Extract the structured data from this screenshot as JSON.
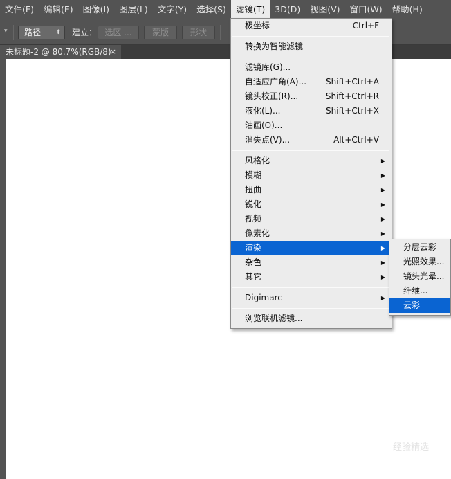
{
  "menubar": {
    "items": [
      "文件(F)",
      "编辑(E)",
      "图像(I)",
      "图层(L)",
      "文字(Y)",
      "选择(S)",
      "滤镜(T)",
      "3D(D)",
      "视图(V)",
      "窗口(W)",
      "帮助(H)"
    ]
  },
  "options": {
    "tool_preset_icon": "dropdown-arrow",
    "path_mode": "路径",
    "make_label": "建立：",
    "selection_button": "选区 ...",
    "mask_button": "蒙版",
    "shape_button": "形状"
  },
  "document": {
    "tab_title": "未标题-2 @ 80.7%(RGB/8)",
    "close_glyph": "×"
  },
  "filter_menu": {
    "groups": [
      [
        {
          "label": "极坐标",
          "shortcut": "Ctrl+F"
        }
      ],
      [
        {
          "label": "转换为智能滤镜",
          "shortcut": ""
        }
      ],
      [
        {
          "label": "滤镜库(G)...",
          "shortcut": ""
        },
        {
          "label": "自适应广角(A)...",
          "shortcut": "Shift+Ctrl+A"
        },
        {
          "label": "镜头校正(R)...",
          "shortcut": "Shift+Ctrl+R"
        },
        {
          "label": "液化(L)...",
          "shortcut": "Shift+Ctrl+X"
        },
        {
          "label": "油画(O)...",
          "shortcut": ""
        },
        {
          "label": "消失点(V)...",
          "shortcut": "Alt+Ctrl+V"
        }
      ],
      [
        {
          "label": "风格化",
          "submenu": true
        },
        {
          "label": "模糊",
          "submenu": true
        },
        {
          "label": "扭曲",
          "submenu": true
        },
        {
          "label": "锐化",
          "submenu": true
        },
        {
          "label": "视频",
          "submenu": true
        },
        {
          "label": "像素化",
          "submenu": true
        },
        {
          "label": "渲染",
          "submenu": true,
          "highlighted": true
        },
        {
          "label": "杂色",
          "submenu": true
        },
        {
          "label": "其它",
          "submenu": true
        }
      ],
      [
        {
          "label": "Digimarc",
          "submenu": true
        }
      ],
      [
        {
          "label": "浏览联机滤镜...",
          "shortcut": ""
        }
      ]
    ]
  },
  "render_submenu": {
    "items": [
      {
        "label": "分层云彩"
      },
      {
        "label": "光照效果..."
      },
      {
        "label": "镜头光晕..."
      },
      {
        "label": "纤维..."
      },
      {
        "label": "云彩",
        "highlighted": true
      }
    ]
  },
  "watermark_text": "经验精选",
  "colors": {
    "highlight": "#0a64d2",
    "menu_bg": "#ececec",
    "chrome_bg": "#535353",
    "canvas_bg": "#ffffff"
  }
}
